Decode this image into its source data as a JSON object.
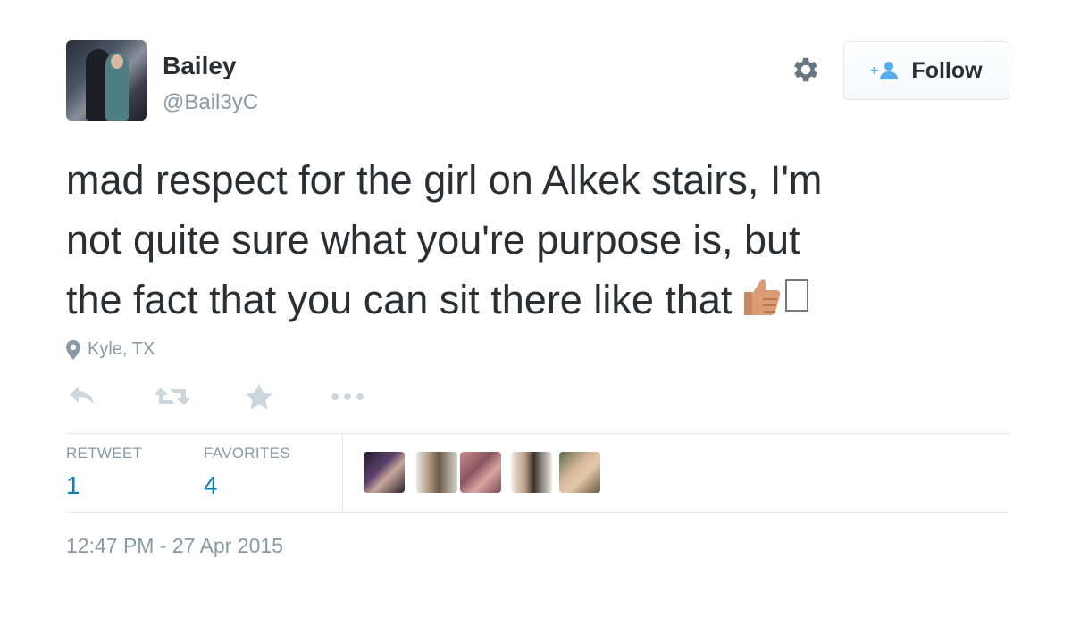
{
  "user": {
    "name": "Bailey",
    "handle": "@Bail3yC"
  },
  "follow_button": {
    "label": "Follow"
  },
  "tweet": {
    "lines": [
      "mad respect for the girl on Alkek stairs, I'm",
      "not quite sure what you're purpose is, but",
      "the fact that you can sit there like that"
    ]
  },
  "location": "Kyle, TX",
  "actions": [
    "reply-icon",
    "retweet-icon",
    "favorite-icon",
    "more-icon"
  ],
  "stats": {
    "retweet_label": "RETWEET",
    "retweet_count": "1",
    "favorites_label": "FAVORITES",
    "favorites_count": "4"
  },
  "timestamp": "12:47 PM - 27 Apr 2015",
  "colors": {
    "text": "#292f33",
    "muted": "#8899a6",
    "link": "#0084b4",
    "border": "#e1e8ed",
    "follow_icon": "#55acee"
  }
}
